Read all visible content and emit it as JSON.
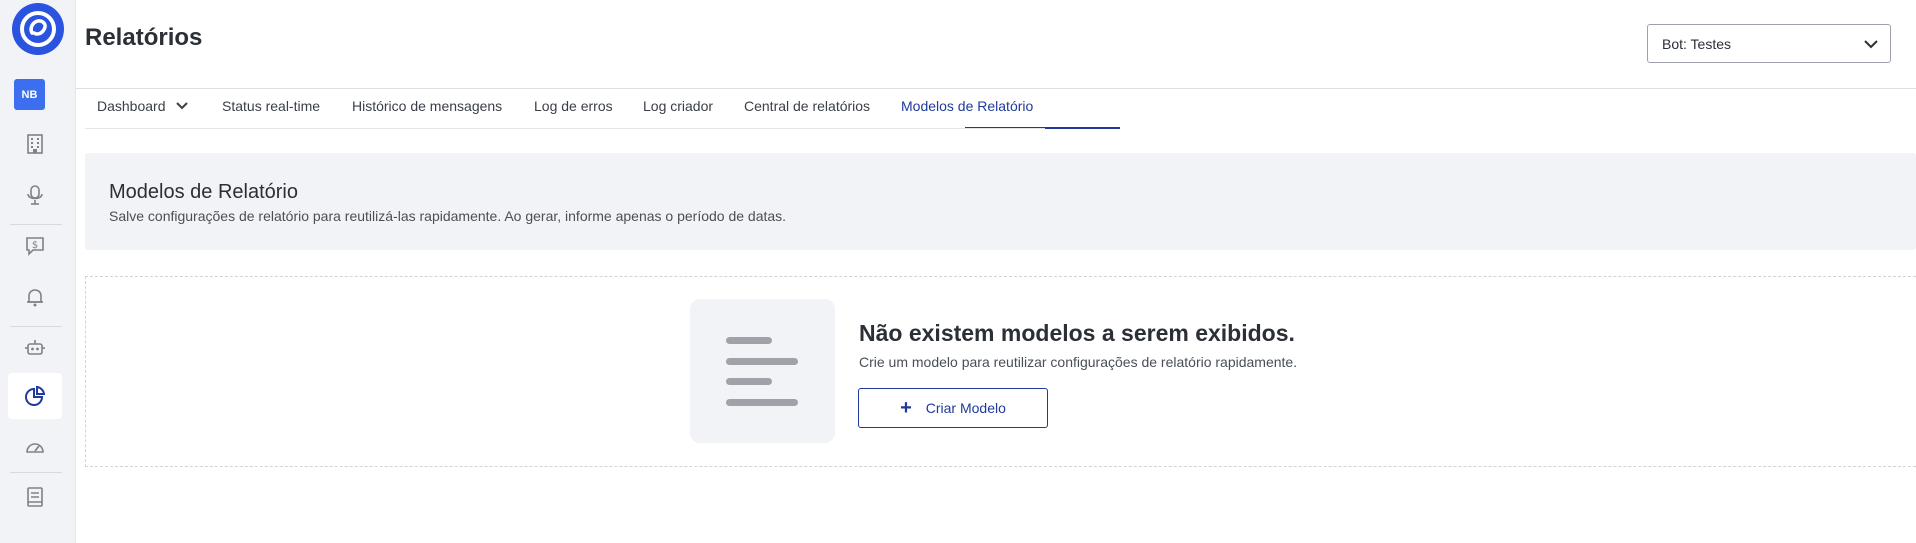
{
  "sidebar": {
    "workspace_badge": "NB",
    "items": [
      {
        "icon": "building-icon"
      },
      {
        "icon": "microphone-icon"
      },
      {
        "icon": "billing-chat-icon"
      },
      {
        "icon": "bell-icon"
      },
      {
        "icon": "robot-icon"
      },
      {
        "icon": "pie-chart-icon",
        "active": true
      },
      {
        "icon": "speedometer-icon"
      },
      {
        "icon": "book-icon"
      }
    ]
  },
  "header": {
    "title": "Relatórios",
    "bot_select": "Bot: Testes"
  },
  "tabs": [
    {
      "label": "Dashboard",
      "has_dropdown": true
    },
    {
      "label": "Status real-time"
    },
    {
      "label": "Histórico de mensagens"
    },
    {
      "label": "Log de erros"
    },
    {
      "label": "Log criador"
    },
    {
      "label": "Central de relatórios"
    },
    {
      "label": "Modelos de Relatório",
      "active": true
    }
  ],
  "info": {
    "title": "Modelos de Relatório",
    "description": "Salve configurações de relatório para reutilizá-las rapidamente. Ao gerar, informe apenas o período de datas."
  },
  "empty_state": {
    "title": "Não existem modelos a serem exibidos.",
    "description": "Crie um modelo para reutilizar configurações de relatório rapidamente.",
    "button_label": "Criar Modelo"
  },
  "colors": {
    "brand": "#2a53e0",
    "accent": "#1f3a9c",
    "sidebar_bg": "#f2f3f6"
  }
}
